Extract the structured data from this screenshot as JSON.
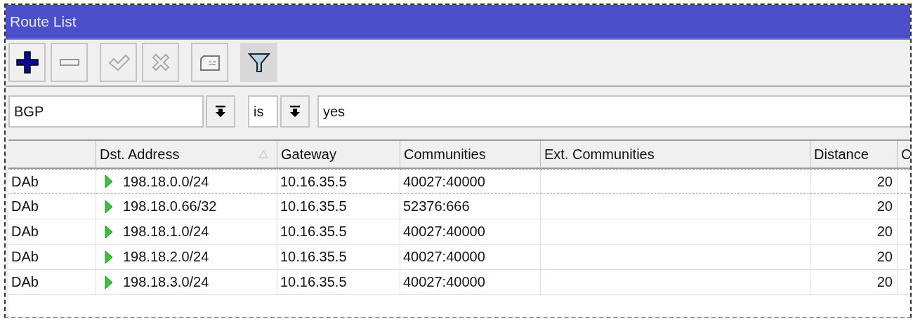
{
  "window": {
    "title": "Route List"
  },
  "toolbar": [
    {
      "kind": "add",
      "selected": false
    },
    {
      "kind": "remove",
      "selected": false
    },
    {
      "kind": "enable",
      "selected": false
    },
    {
      "kind": "disable",
      "selected": false
    },
    {
      "kind": "comment",
      "selected": false
    },
    {
      "kind": "filter",
      "selected": true
    }
  ],
  "filter": {
    "property": "BGP",
    "operator": "is",
    "value": "yes"
  },
  "table": {
    "columns": [
      {
        "label": "Dst. Address",
        "sorted": true
      },
      {
        "label": "Gateway",
        "sorted": false
      },
      {
        "label": "Communities",
        "sorted": false
      },
      {
        "label": "Ext. Communities",
        "sorted": false
      },
      {
        "label": "Distance",
        "sorted": false
      },
      {
        "label": "C"
      }
    ],
    "rows": [
      {
        "flags": "DAb",
        "dst_address": "198.18.0.0/24",
        "gateway": "10.16.35.5",
        "communities": "40027:40000",
        "distance": "20",
        "focused": true
      },
      {
        "flags": "DAb",
        "dst_address": "198.18.0.66/32",
        "gateway": "10.16.35.5",
        "communities": "52376:666",
        "distance": "20",
        "focused": false
      },
      {
        "flags": "DAb",
        "dst_address": "198.18.1.0/24",
        "gateway": "10.16.35.5",
        "communities": "40027:40000",
        "distance": "20",
        "focused": false
      },
      {
        "flags": "DAb",
        "dst_address": "198.18.2.0/24",
        "gateway": "10.16.35.5",
        "communities": "40027:40000",
        "distance": "20",
        "focused": false
      },
      {
        "flags": "DAb",
        "dst_address": "198.18.3.0/24",
        "gateway": "10.16.35.5",
        "communities": "40027:40000",
        "distance": "20",
        "focused": false
      }
    ]
  }
}
